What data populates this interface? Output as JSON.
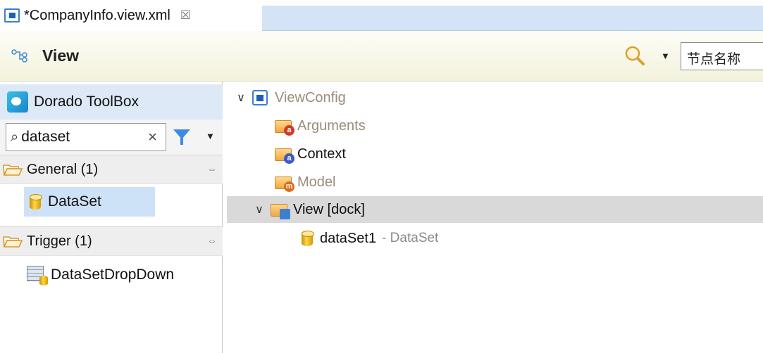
{
  "editor_tab": {
    "title": "*CompanyInfo.view.xml",
    "close": "☒"
  },
  "header": {
    "title": "View",
    "node_search_placeholder": "节点名称",
    "dropdown_glyph": "▼"
  },
  "toolbox": {
    "title": "Dorado ToolBox",
    "filter_value": "dataset",
    "clear_glyph": "×",
    "filter_dropdown_glyph": "▼",
    "sections": [
      {
        "title": "General (1)",
        "pin_glyph": "⇔",
        "items": [
          {
            "label": "DataSet",
            "selected": true
          }
        ]
      },
      {
        "title": "Trigger (1)",
        "pin_glyph": "⇔",
        "items": [
          {
            "label": "DataSetDropDown",
            "selected": false
          }
        ]
      }
    ]
  },
  "tree": {
    "expanded_glyph": "∨",
    "nodes": [
      {
        "label": "ViewConfig",
        "level": 0
      },
      {
        "label": "Arguments",
        "level": 1,
        "badge": "a",
        "badge_color": "#d43a2a"
      },
      {
        "label": "Context",
        "level": 1,
        "badge": "a",
        "badge_color": "#3c58c8"
      },
      {
        "label": "Model",
        "level": 1,
        "badge": "m",
        "badge_color": "#e06a1a"
      },
      {
        "label": "View [dock]",
        "level": 1,
        "highlighted": true
      },
      {
        "label": "dataSet1",
        "type": "- DataSet",
        "level": 2
      }
    ]
  }
}
